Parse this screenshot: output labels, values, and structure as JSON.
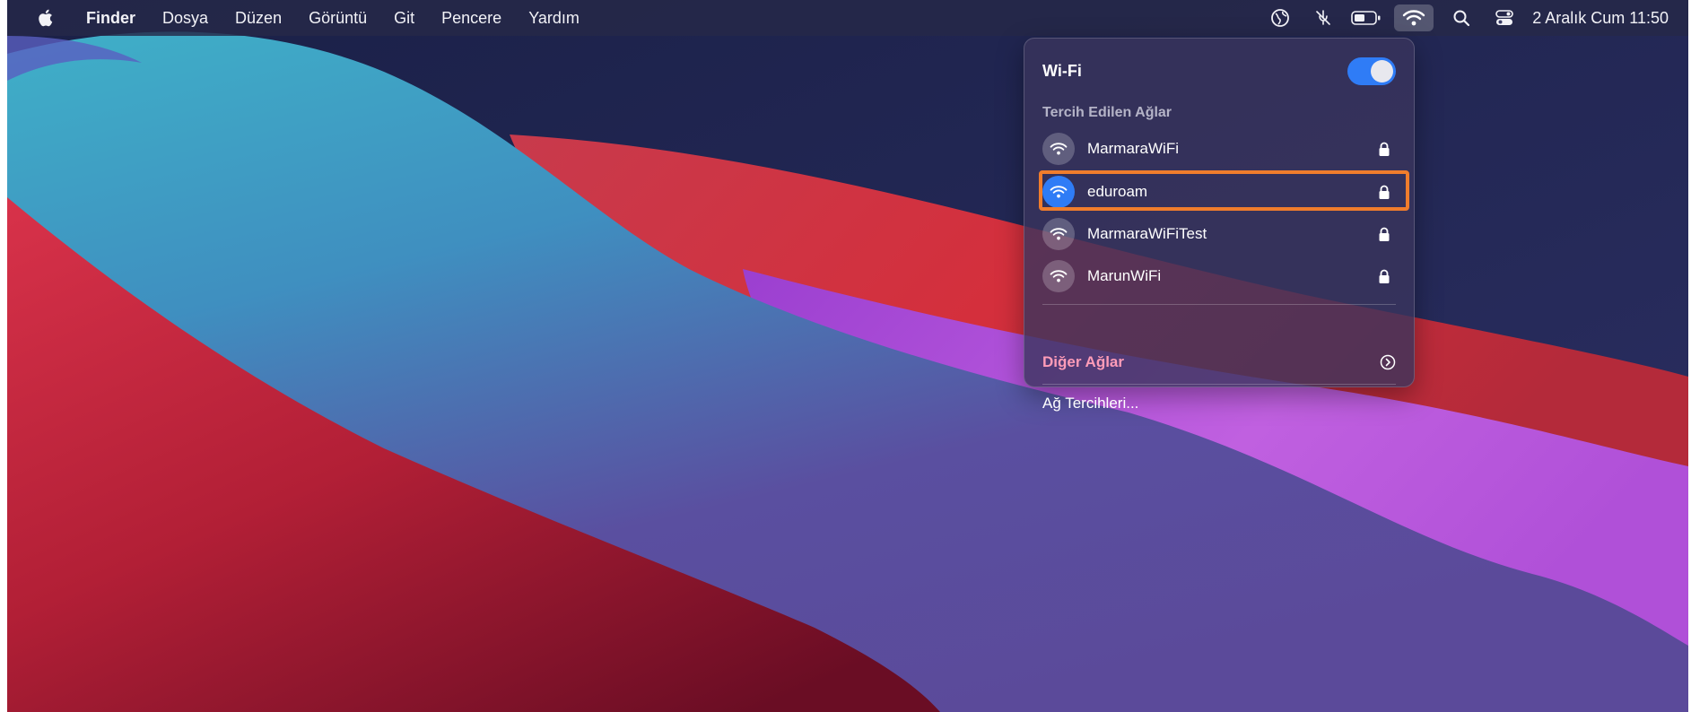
{
  "menubar": {
    "app_name": "Finder",
    "items": [
      "Dosya",
      "Düzen",
      "Görüntü",
      "Git",
      "Pencere",
      "Yardım"
    ],
    "clock": "2 Aralık Cum 11:50",
    "status_icons": [
      "globe-icon",
      "mic-muted-icon",
      "battery-icon",
      "wifi-icon",
      "search-icon",
      "control-center-icon"
    ]
  },
  "wifi_menu": {
    "title": "Wi-Fi",
    "toggle_on": true,
    "section_label": "Tercih Edilen Ağlar",
    "networks": [
      {
        "name": "MarmaraWiFi",
        "locked": true,
        "connected": false
      },
      {
        "name": "eduroam",
        "locked": true,
        "connected": true
      },
      {
        "name": "MarmaraWiFiTest",
        "locked": true,
        "connected": false
      },
      {
        "name": "MarunWiFi",
        "locked": true,
        "connected": false
      }
    ],
    "other_networks_label": "Diğer Ağlar",
    "preferences_label": "Ağ Tercihleri...",
    "highlighted_network": "eduroam"
  },
  "colors": {
    "accent": "#2f7cf6",
    "highlight_border": "#f07d2c",
    "other_networks_text": "#ff9cb8"
  }
}
